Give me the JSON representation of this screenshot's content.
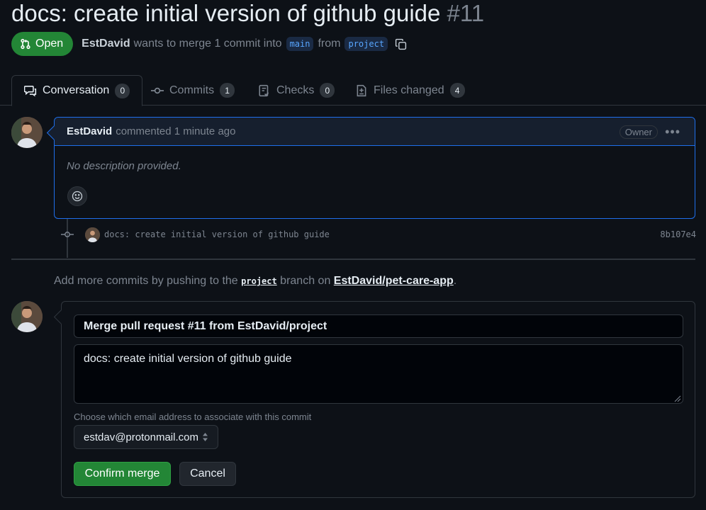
{
  "pr": {
    "title": "docs: create initial version of github guide",
    "number": "#11",
    "state": "Open",
    "author": "EstDavid",
    "merge_text": "wants to merge 1 commit into",
    "base_branch": "main",
    "from_text": "from",
    "head_branch": "project"
  },
  "tabs": [
    {
      "label": "Conversation",
      "count": "0",
      "icon": "conversation-icon"
    },
    {
      "label": "Commits",
      "count": "1",
      "icon": "commit-icon"
    },
    {
      "label": "Checks",
      "count": "0",
      "icon": "checklist-icon"
    },
    {
      "label": "Files changed",
      "count": "4",
      "icon": "file-diff-icon"
    }
  ],
  "comment": {
    "author": "EstDavid",
    "action": "commented 1 minute ago",
    "role_badge": "Owner",
    "body": "No description provided."
  },
  "commit": {
    "message": "docs: create initial version of github guide",
    "sha": "8b107e4"
  },
  "hint": {
    "prefix": "Add more commits by pushing to the",
    "branch": "project",
    "middle": "branch on",
    "repo": "EstDavid/pet-care-app",
    "suffix": "."
  },
  "merge": {
    "title_value": "Merge pull request #11 from EstDavid/project",
    "body_value": "docs: create initial version of github guide",
    "email_label": "Choose which email address to associate with this commit",
    "email_selected": "estdav@protonmail.com",
    "confirm_label": "Confirm merge",
    "cancel_label": "Cancel"
  },
  "colors": {
    "accent_green": "#238636",
    "accent_blue": "#1f6feb",
    "background": "#0d1117"
  }
}
